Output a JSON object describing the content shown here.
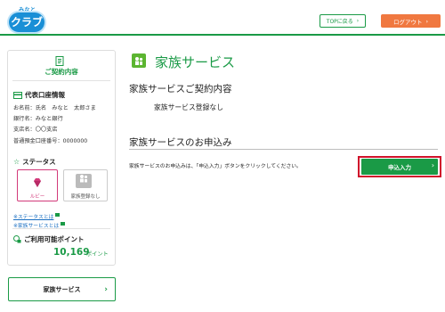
{
  "header": {
    "logo_small": "みなと",
    "logo_main": "クラブ",
    "top_button": "TOPに戻る",
    "logout_button": "ログアウト"
  },
  "sidebar": {
    "contract_title": "ご契約内容",
    "account": {
      "heading": "代表口座情報",
      "name": "お名前：氏名　みなと　太郎さま",
      "bank": "銀行名：みなと銀行",
      "branch": "支店名：〇〇支店",
      "number": "普通預金口座番号：0000000"
    },
    "status": {
      "heading": "ステータス",
      "ruby_label": "ルビー",
      "family_label": "家族登録なし",
      "link_status": "※ステータスとは",
      "link_family": "※家族サービスとは"
    },
    "points": {
      "heading": "ご利用可能ポイント",
      "value": "10,169",
      "unit": "ポイント"
    },
    "family_button": "家族サービス"
  },
  "main": {
    "title": "家族サービス",
    "contract_heading": "家族サービスご契約内容",
    "contract_status": "家族サービス登録なし",
    "apply_heading": "家族サービスのお申込み",
    "apply_note": "家族サービスのお申込みは、「申込入力」ボタンをクリックしてください。",
    "apply_button": "申込入力"
  },
  "colors": {
    "accent_green": "#1a9a46",
    "logout_orange": "#f07840",
    "highlight_red": "#d0122b",
    "logo_blue": "#1a8fd6"
  }
}
